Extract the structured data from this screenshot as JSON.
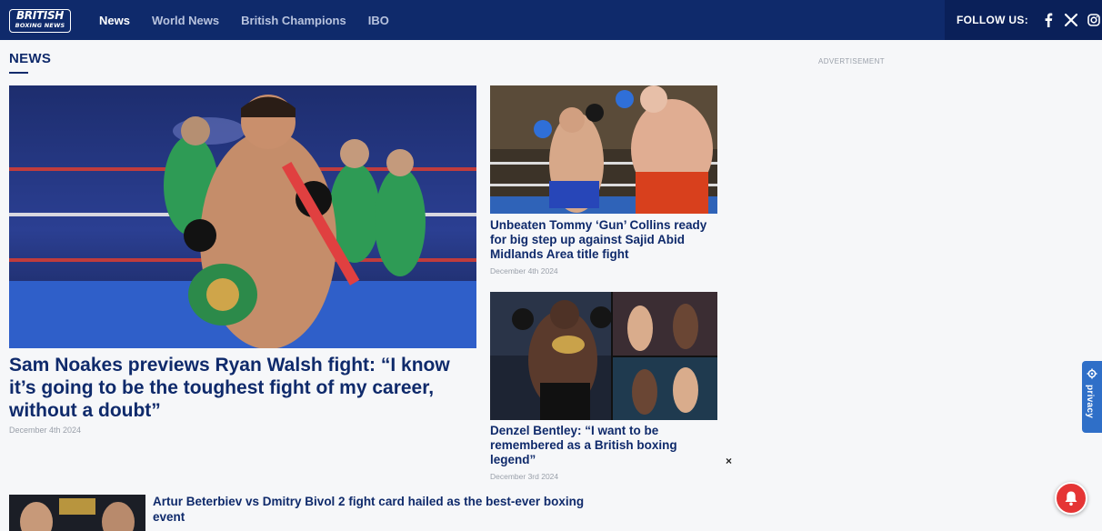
{
  "brand": {
    "line1": "BRITISH",
    "line2": "BOXING NEWS"
  },
  "nav": {
    "items": [
      "News",
      "World News",
      "British Champions",
      "IBO"
    ]
  },
  "follow": {
    "label": "FOLLOW US:"
  },
  "section": {
    "title": "NEWS"
  },
  "ad": {
    "label": "ADVERTISEMENT"
  },
  "main_article": {
    "title": "Sam Noakes previews Ryan Walsh fight: “I know it’s going to be the toughest fight of my career, without a doubt”",
    "date": "December 4th 2024"
  },
  "side_articles": [
    {
      "title": "Unbeaten Tommy ‘Gun’ Collins ready for big step up against Sajid Abid Midlands Area title fight",
      "date": "December 4th 2024"
    },
    {
      "title": "Denzel Bentley: “I want to be remembered as a British boxing legend”",
      "date": "December 3rd 2024"
    }
  ],
  "bottom_article": {
    "title": "Artur Beterbiev vs Dmitry Bivol 2 fight card hailed as the best-ever boxing event"
  },
  "privacy": {
    "label": "privacy"
  },
  "close": {
    "label": "×"
  },
  "colors": {
    "navy": "#0f2a6b",
    "bell": "#e53535",
    "privacy": "#2f6fc8"
  }
}
